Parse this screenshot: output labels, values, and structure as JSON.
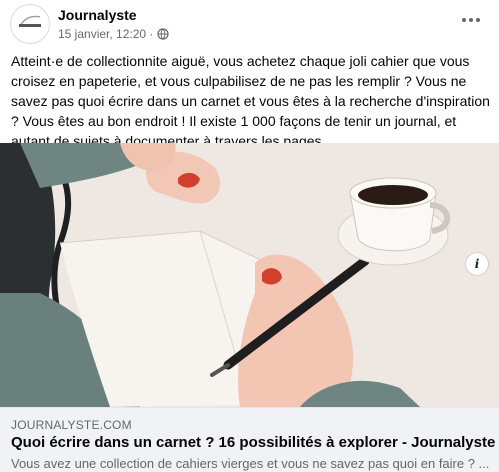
{
  "post": {
    "author": "Journalyste",
    "date": "15 janvier, 12:20 ·",
    "privacy_icon": "globe-icon",
    "more_icon": "more-options-icon",
    "text": "Atteint·e de collectionnite aiguë, vous achetez chaque joli cahier que vous croisez en papeterie, et vous culpabilisez de ne pas les remplir ? Vous ne savez pas quoi écrire dans un carnet et vous êtes à la recherche d'inspiration ? Vous êtes au bon endroit ! Il existe 1 000 façons de tenir un journal, et autant de sujets à documenter à travers les pages...."
  },
  "link_preview": {
    "domain": "JOURNALYSTE.COM",
    "title": "Quoi écrire dans un carnet ? 16 possibilités à explorer - Journalyste",
    "description": "Vous avez une collection de cahiers vierges et vous ne savez pas quoi en faire ? ...",
    "info_label": "i"
  },
  "colors": {
    "secondary_text": "#65676b",
    "link_bg": "#f0f2f5",
    "nail_polish": "#d1402c"
  }
}
